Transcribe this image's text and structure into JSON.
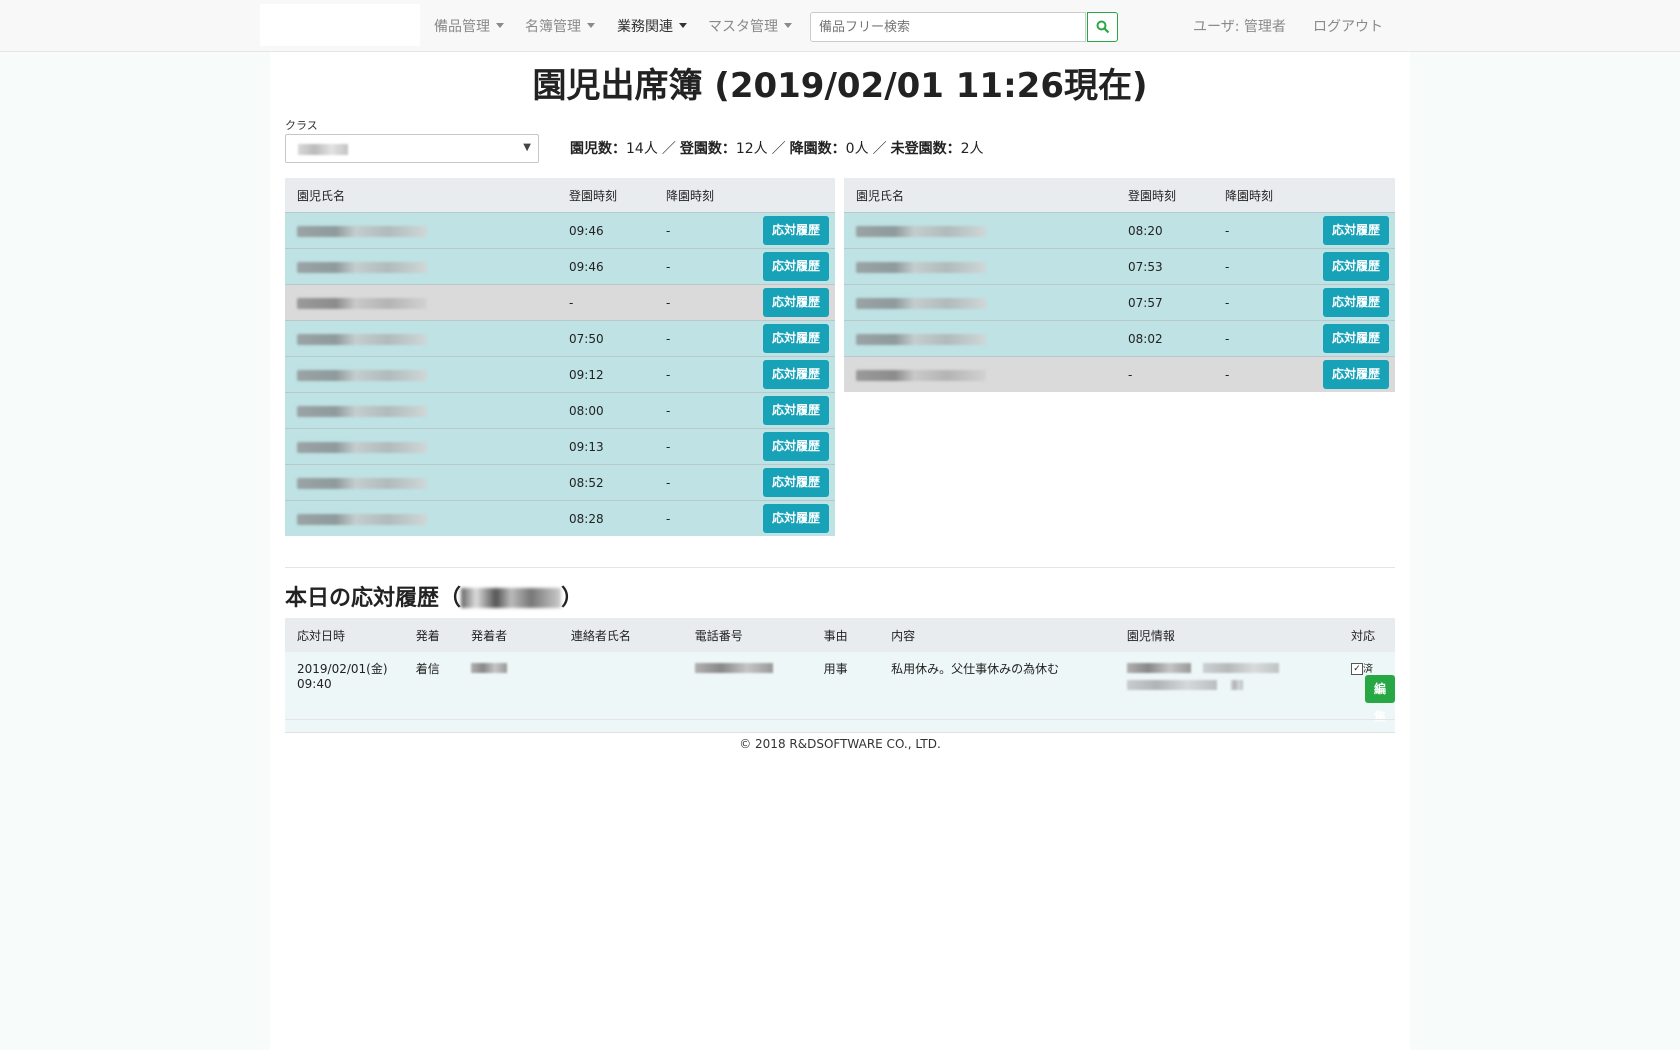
{
  "nav": {
    "items": [
      {
        "label": "備品管理",
        "active": false
      },
      {
        "label": "名簿管理",
        "active": false
      },
      {
        "label": "業務関連",
        "active": true
      },
      {
        "label": "マスタ管理",
        "active": false
      }
    ],
    "search_placeholder": "備品フリー検索",
    "user_label": "ユーザ: 管理者",
    "logout_label": "ログアウト"
  },
  "page": {
    "title": "園児出席簿 (2019/02/01 11:26現在)",
    "class_label": "クラス",
    "counts": {
      "children_label": "園児数：",
      "children_value": "14人",
      "sep1": "／",
      "arrived_label": "登園数：",
      "arrived_value": "12人",
      "sep2": "／",
      "left_label": "降園数：",
      "left_value": "0人",
      "sep3": "／",
      "absent_label": "未登園数：",
      "absent_value": "2人"
    }
  },
  "attendance": {
    "headers": {
      "name": "園児氏名",
      "arrive": "登園時刻",
      "leave": "降園時刻"
    },
    "button_label": "応対履歴",
    "left": [
      {
        "arrive": "09:46",
        "leave": "-",
        "status": "present"
      },
      {
        "arrive": "09:46",
        "leave": "-",
        "status": "present"
      },
      {
        "arrive": "-",
        "leave": "-",
        "status": "absent"
      },
      {
        "arrive": "07:50",
        "leave": "-",
        "status": "present"
      },
      {
        "arrive": "09:12",
        "leave": "-",
        "status": "present"
      },
      {
        "arrive": "08:00",
        "leave": "-",
        "status": "present"
      },
      {
        "arrive": "09:13",
        "leave": "-",
        "status": "present"
      },
      {
        "arrive": "08:52",
        "leave": "-",
        "status": "present"
      },
      {
        "arrive": "08:28",
        "leave": "-",
        "status": "present"
      }
    ],
    "right": [
      {
        "arrive": "08:20",
        "leave": "-",
        "status": "present"
      },
      {
        "arrive": "07:53",
        "leave": "-",
        "status": "present"
      },
      {
        "arrive": "07:57",
        "leave": "-",
        "status": "present"
      },
      {
        "arrive": "08:02",
        "leave": "-",
        "status": "present"
      },
      {
        "arrive": "-",
        "leave": "-",
        "status": "absent"
      }
    ]
  },
  "history": {
    "title_prefix": "本日の応対履歴（",
    "title_suffix": "）",
    "headers": [
      "応対日時",
      "発着",
      "発着者",
      "連絡者氏名",
      "電話番号",
      "事由",
      "内容",
      "園児情報",
      "対応"
    ],
    "rows": [
      {
        "date": "2019/02/01(金)",
        "time": "09:40",
        "direction": "着信",
        "reason": "用事",
        "content": "私用休み。父仕事休みの為休む",
        "done_label": "済",
        "edit_label": "編集"
      }
    ]
  },
  "footer": {
    "copyright": "© 2018 R&DSOFTWARE CO., LTD."
  },
  "colors": {
    "info": "#17a2b8",
    "success": "#28a745",
    "present_row": "#bfe2e4",
    "absent_row": "#dadada"
  }
}
